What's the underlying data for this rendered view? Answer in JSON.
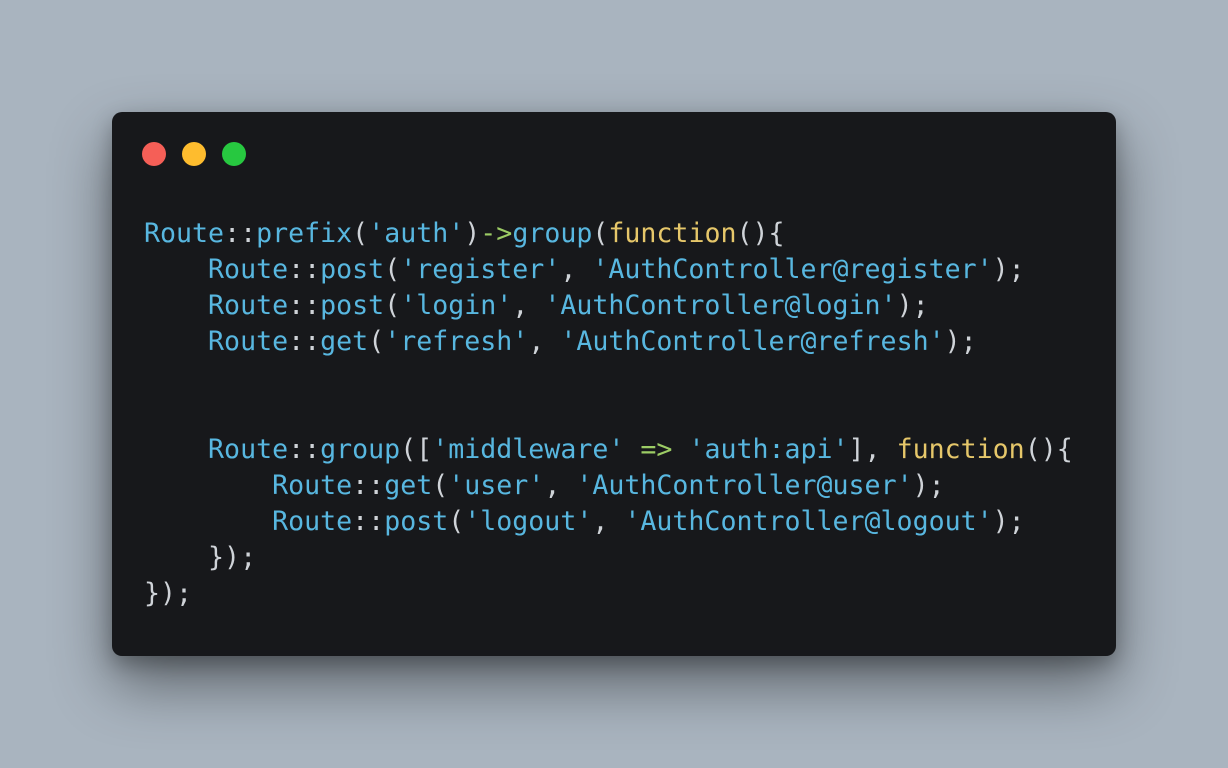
{
  "colors": {
    "background": "#a9b4bf",
    "editor_background": "#17181b",
    "identifier": "#58b7e0",
    "punctuation": "#cfd3d8",
    "keyword": "#e6c76a",
    "string": "#58b7e0",
    "operator": "#9ccc65",
    "window_buttons": {
      "close": "#f55f57",
      "minimize": "#febc2e",
      "maximize": "#27c840"
    }
  },
  "window_controls": [
    {
      "name": "close-button",
      "color": "#f55f57"
    },
    {
      "name": "minimize-button",
      "color": "#febc2e"
    },
    {
      "name": "maximize-button",
      "color": "#27c840"
    }
  ],
  "code_lines": [
    [
      {
        "t": "ident",
        "v": "Route"
      },
      {
        "t": "punct",
        "v": "::"
      },
      {
        "t": "ident",
        "v": "prefix"
      },
      {
        "t": "punct",
        "v": "("
      },
      {
        "t": "str",
        "v": "'auth'"
      },
      {
        "t": "punct",
        "v": ")"
      },
      {
        "t": "op",
        "v": "->"
      },
      {
        "t": "ident",
        "v": "group"
      },
      {
        "t": "punct",
        "v": "("
      },
      {
        "t": "kw",
        "v": "function"
      },
      {
        "t": "punct",
        "v": "(){"
      }
    ],
    [
      {
        "t": "punct",
        "v": "    "
      },
      {
        "t": "ident",
        "v": "Route"
      },
      {
        "t": "punct",
        "v": "::"
      },
      {
        "t": "ident",
        "v": "post"
      },
      {
        "t": "punct",
        "v": "("
      },
      {
        "t": "str",
        "v": "'register'"
      },
      {
        "t": "punct",
        "v": ", "
      },
      {
        "t": "str",
        "v": "'AuthController@register'"
      },
      {
        "t": "punct",
        "v": ");"
      }
    ],
    [
      {
        "t": "punct",
        "v": "    "
      },
      {
        "t": "ident",
        "v": "Route"
      },
      {
        "t": "punct",
        "v": "::"
      },
      {
        "t": "ident",
        "v": "post"
      },
      {
        "t": "punct",
        "v": "("
      },
      {
        "t": "str",
        "v": "'login'"
      },
      {
        "t": "punct",
        "v": ", "
      },
      {
        "t": "str",
        "v": "'AuthController@login'"
      },
      {
        "t": "punct",
        "v": ");"
      }
    ],
    [
      {
        "t": "punct",
        "v": "    "
      },
      {
        "t": "ident",
        "v": "Route"
      },
      {
        "t": "punct",
        "v": "::"
      },
      {
        "t": "ident",
        "v": "get"
      },
      {
        "t": "punct",
        "v": "("
      },
      {
        "t": "str",
        "v": "'refresh'"
      },
      {
        "t": "punct",
        "v": ", "
      },
      {
        "t": "str",
        "v": "'AuthController@refresh'"
      },
      {
        "t": "punct",
        "v": ");"
      }
    ],
    [],
    [],
    [
      {
        "t": "punct",
        "v": "    "
      },
      {
        "t": "ident",
        "v": "Route"
      },
      {
        "t": "punct",
        "v": "::"
      },
      {
        "t": "ident",
        "v": "group"
      },
      {
        "t": "punct",
        "v": "(["
      },
      {
        "t": "str",
        "v": "'middleware'"
      },
      {
        "t": "punct",
        "v": " "
      },
      {
        "t": "op",
        "v": "=>"
      },
      {
        "t": "punct",
        "v": " "
      },
      {
        "t": "str",
        "v": "'auth:api'"
      },
      {
        "t": "punct",
        "v": "], "
      },
      {
        "t": "kw",
        "v": "function"
      },
      {
        "t": "punct",
        "v": "(){"
      }
    ],
    [
      {
        "t": "punct",
        "v": "        "
      },
      {
        "t": "ident",
        "v": "Route"
      },
      {
        "t": "punct",
        "v": "::"
      },
      {
        "t": "ident",
        "v": "get"
      },
      {
        "t": "punct",
        "v": "("
      },
      {
        "t": "str",
        "v": "'user'"
      },
      {
        "t": "punct",
        "v": ", "
      },
      {
        "t": "str",
        "v": "'AuthController@user'"
      },
      {
        "t": "punct",
        "v": ");"
      }
    ],
    [
      {
        "t": "punct",
        "v": "        "
      },
      {
        "t": "ident",
        "v": "Route"
      },
      {
        "t": "punct",
        "v": "::"
      },
      {
        "t": "ident",
        "v": "post"
      },
      {
        "t": "punct",
        "v": "("
      },
      {
        "t": "str",
        "v": "'logout'"
      },
      {
        "t": "punct",
        "v": ", "
      },
      {
        "t": "str",
        "v": "'AuthController@logout'"
      },
      {
        "t": "punct",
        "v": ");"
      }
    ],
    [
      {
        "t": "punct",
        "v": "    });"
      }
    ],
    [
      {
        "t": "punct",
        "v": "});"
      }
    ]
  ]
}
